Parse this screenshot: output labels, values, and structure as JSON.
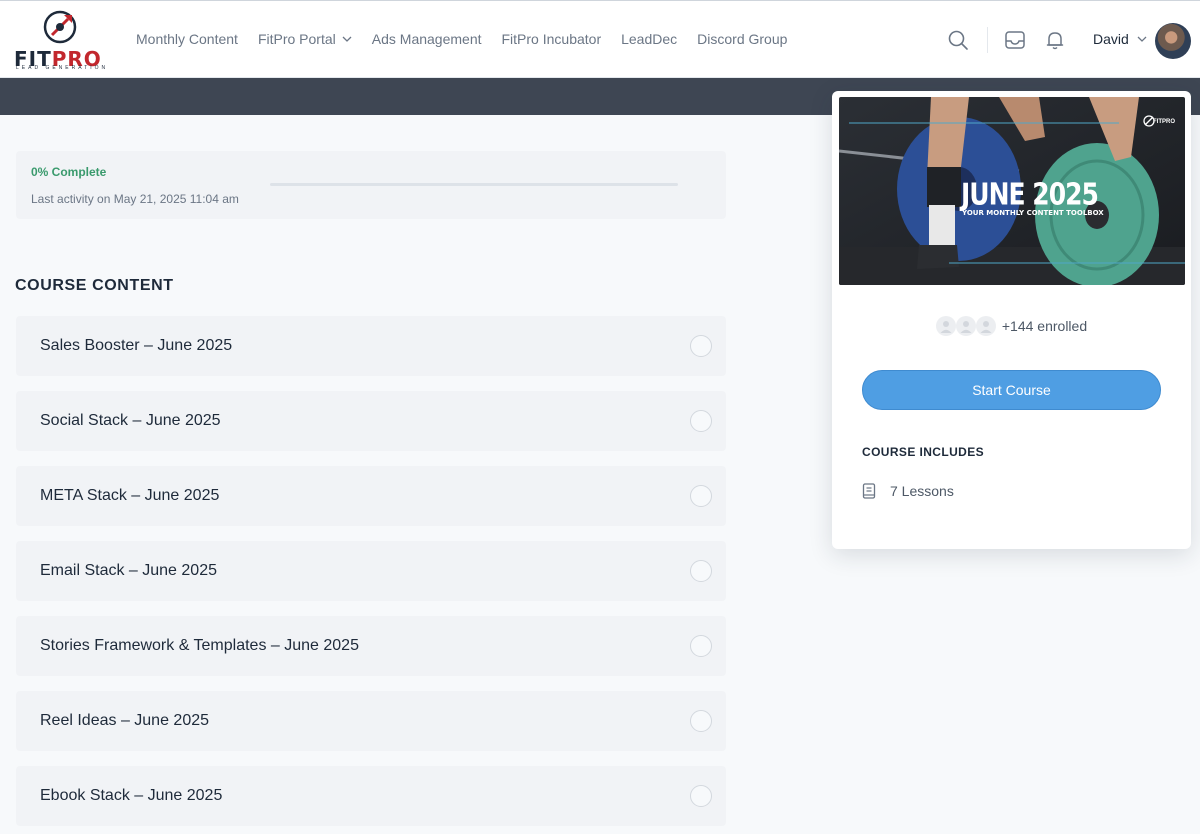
{
  "brand": {
    "logo_main": "FIT",
    "logo_accent": "PRO",
    "logo_tagline": "LEAD GENERATION",
    "accent_color": "#c2272d"
  },
  "nav": {
    "items": [
      {
        "label": "Monthly Content",
        "has_dropdown": false
      },
      {
        "label": "FitPro Portal",
        "has_dropdown": true
      },
      {
        "label": "Ads Management",
        "has_dropdown": false
      },
      {
        "label": "FitPro Incubator",
        "has_dropdown": false
      },
      {
        "label": "LeadDec",
        "has_dropdown": false
      },
      {
        "label": "Discord Group",
        "has_dropdown": false
      }
    ]
  },
  "header_icons": [
    "search-icon",
    "inbox-icon",
    "bell-icon"
  ],
  "user": {
    "name": "David"
  },
  "progress": {
    "percent_label": "0% Complete",
    "percent": 0,
    "last_activity": "Last activity on May 21, 2025 11:04 am",
    "color": "#3a9a6d"
  },
  "course_content": {
    "title": "COURSE CONTENT",
    "lessons": [
      {
        "title": "Sales Booster – June 2025",
        "completed": false
      },
      {
        "title": "Social Stack – June 2025",
        "completed": false
      },
      {
        "title": "META Stack – June 2025",
        "completed": false
      },
      {
        "title": "Email Stack – June 2025",
        "completed": false
      },
      {
        "title": "Stories Framework & Templates – June 2025",
        "completed": false
      },
      {
        "title": "Reel Ideas – June 2025",
        "completed": false
      },
      {
        "title": "Ebook Stack – June 2025",
        "completed": false
      }
    ]
  },
  "side_card": {
    "thumbnail_title": "JUNE 2025",
    "thumbnail_subtitle": "YOUR MONTHLY CONTENT TOOLBOX",
    "thumbnail_brand": "FITPRO",
    "enrolled_label": "+144 enrolled",
    "start_button": "Start Course",
    "button_color": "#4f9ee3",
    "includes_title": "COURSE INCLUDES",
    "includes": [
      {
        "icon": "book-icon",
        "label": "7 Lessons"
      }
    ]
  }
}
